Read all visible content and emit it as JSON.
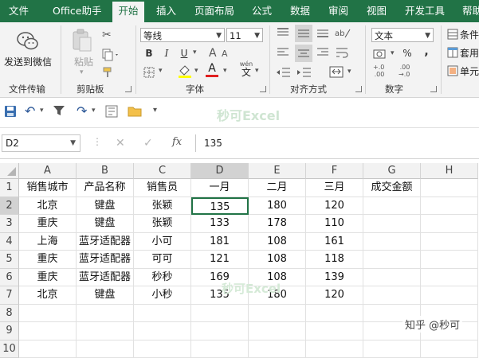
{
  "menu": {
    "tabs": [
      "文件",
      "Office助手",
      "开始",
      "插入",
      "页面布局",
      "公式",
      "数据",
      "审阅",
      "视图",
      "开发工具",
      "帮助"
    ]
  },
  "ribbon": {
    "groups": {
      "file_transfer": "文件传输",
      "clipboard": "剪贴板",
      "font": "字体",
      "alignment": "对齐方式",
      "number": "数字"
    },
    "send_wechat": "发送到微信",
    "paste": "粘贴",
    "font_name": "等线",
    "font_size": "11",
    "number_format": "文本",
    "conditional_format": "条件",
    "table_format": "套用",
    "cell_style": "单元",
    "bold": "B",
    "italic": "I",
    "underline": "U",
    "wen_label": "wén",
    "wen_char": "文",
    "font_letter": "A",
    "percent": "%",
    "comma": ",",
    "dec_increase": "+.0",
    "dec_decrease": ".00",
    "dec_increase2": ".00",
    "dec_decrease2": "→.0"
  },
  "watermark": "秒可Excel",
  "formula_bar": {
    "name_box": "D2",
    "formula": "135",
    "fx": "fx"
  },
  "sheet": {
    "columns": [
      "A",
      "B",
      "C",
      "D",
      "E",
      "F",
      "G",
      "H"
    ],
    "row_numbers": [
      "1",
      "2",
      "3",
      "4",
      "5",
      "6",
      "7",
      "8",
      "9",
      "10"
    ],
    "rows": [
      [
        "销售城市",
        "产品名称",
        "销售员",
        "一月",
        "二月",
        "三月",
        "成交金额",
        ""
      ],
      [
        "北京",
        "键盘",
        "张颖",
        "135",
        "180",
        "120",
        "",
        ""
      ],
      [
        "重庆",
        "键盘",
        "张颖",
        "133",
        "178",
        "110",
        "",
        ""
      ],
      [
        "上海",
        "蓝牙适配器",
        "小可",
        "181",
        "108",
        "161",
        "",
        ""
      ],
      [
        "重庆",
        "蓝牙适配器",
        "可可",
        "121",
        "108",
        "118",
        "",
        ""
      ],
      [
        "重庆",
        "蓝牙适配器",
        "秒秒",
        "169",
        "108",
        "139",
        "",
        ""
      ],
      [
        "北京",
        "键盘",
        "小秒",
        "135",
        "180",
        "120",
        "",
        ""
      ],
      [
        "",
        "",
        "",
        "",
        "",
        "",
        "",
        ""
      ],
      [
        "",
        "",
        "",
        "",
        "",
        "",
        "",
        ""
      ],
      [
        "",
        "",
        "",
        "",
        "",
        "",
        "",
        ""
      ]
    ]
  },
  "zhihu_watermark": "知乎 @秒可"
}
